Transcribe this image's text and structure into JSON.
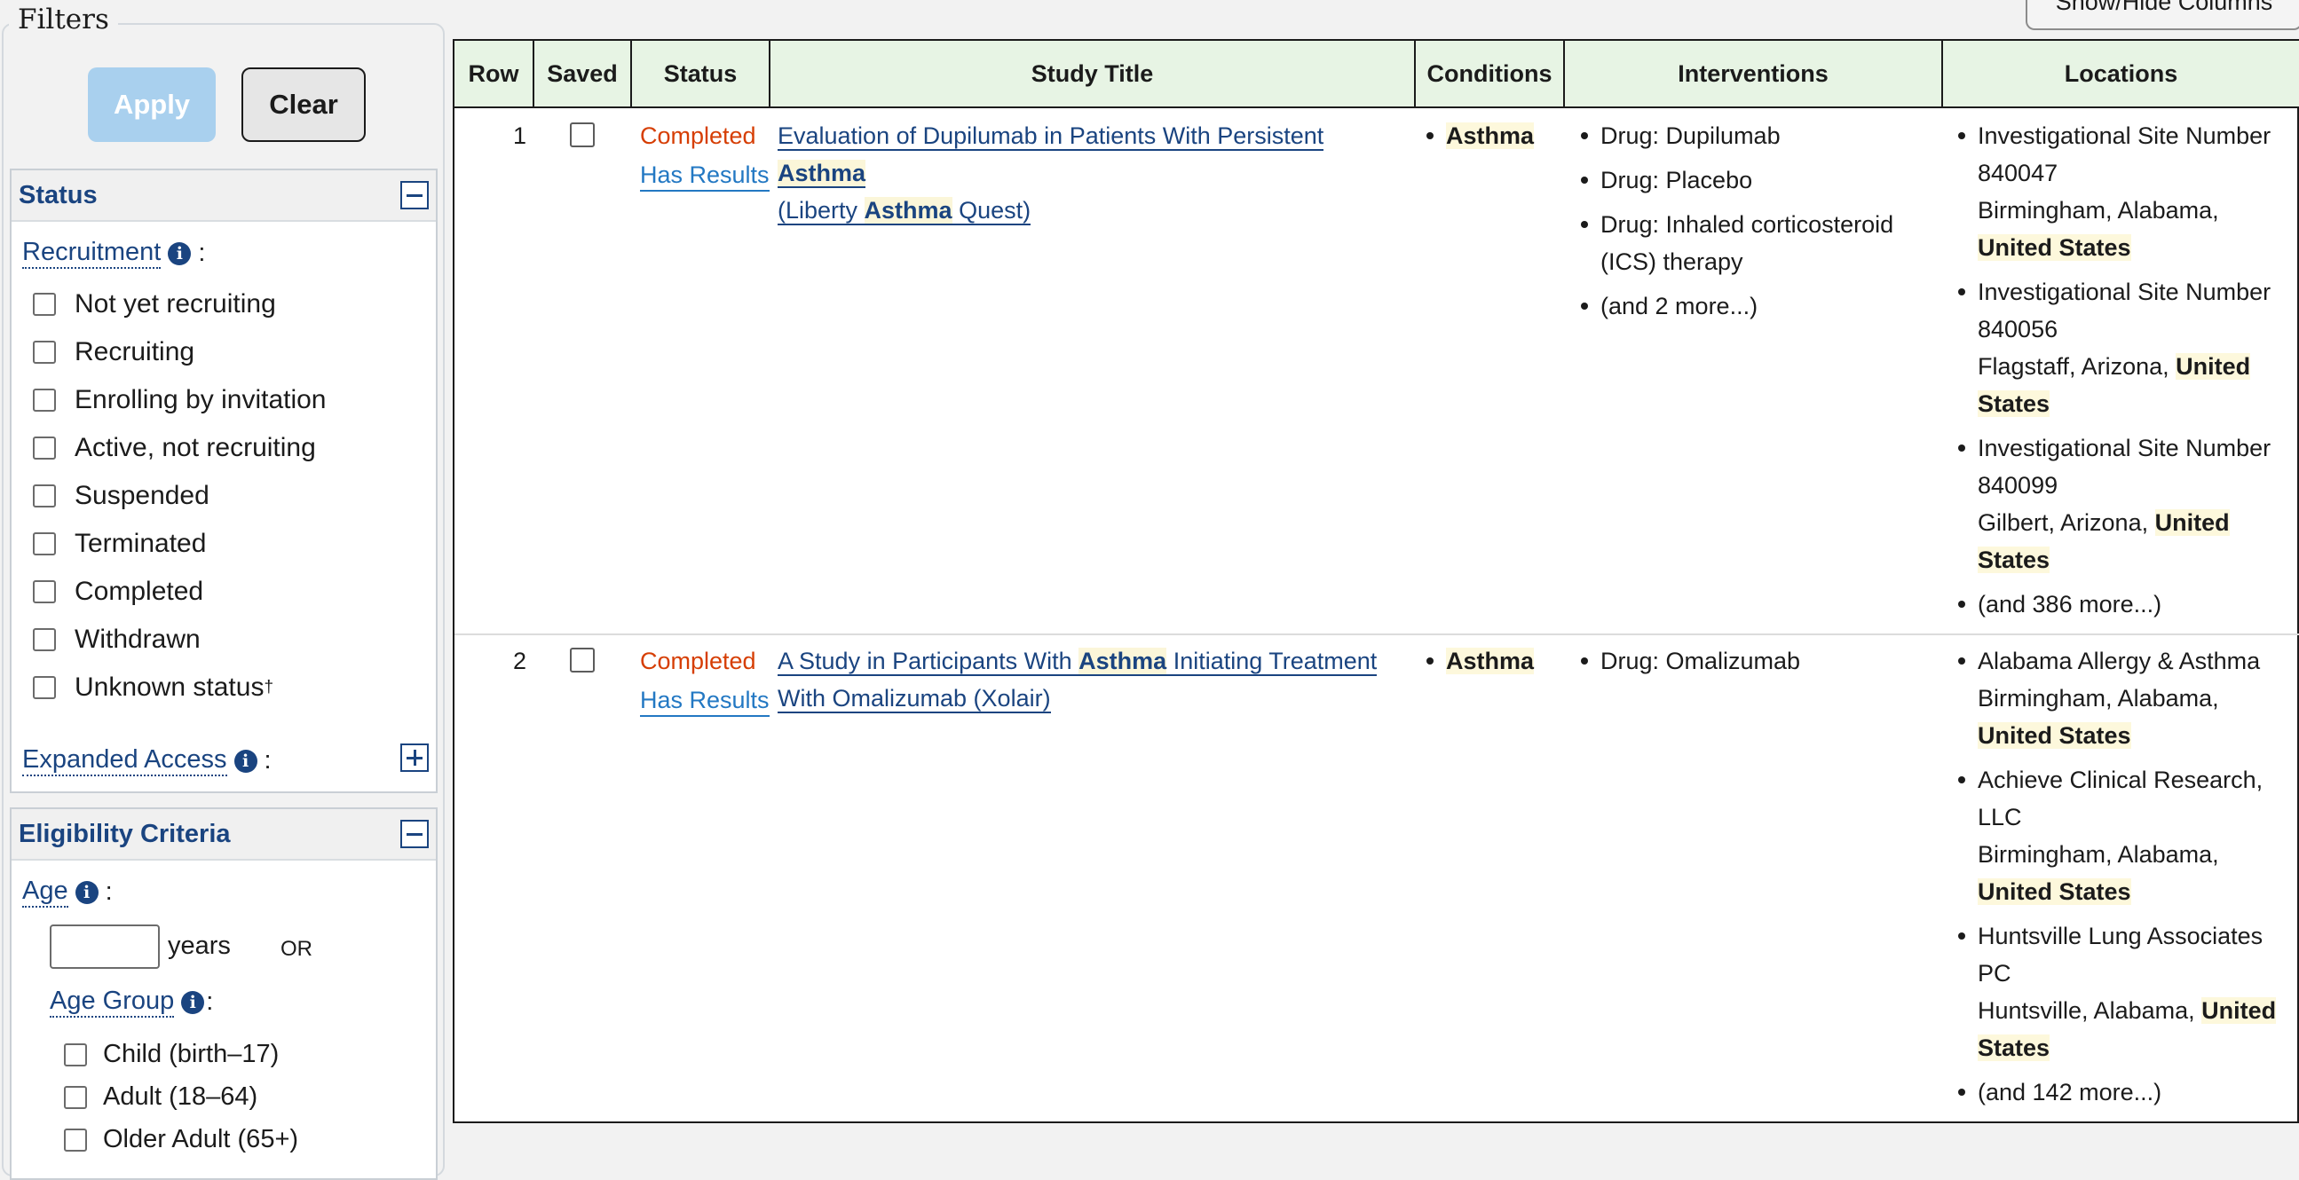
{
  "filters": {
    "legend": "Filters",
    "apply_label": "Apply",
    "clear_label": "Clear"
  },
  "status_section": {
    "title": "Status",
    "recruitment_label": "Recruitment",
    "options": [
      "Not yet recruiting",
      "Recruiting",
      "Enrolling by invitation",
      "Active, not recruiting",
      "Suspended",
      "Terminated",
      "Completed",
      "Withdrawn",
      "Unknown status"
    ],
    "unknown_marker": "†",
    "expanded_access_label": "Expanded Access"
  },
  "eligibility_section": {
    "title": "Eligibility Criteria",
    "age_label": "Age",
    "age_value": "",
    "years_label": "years",
    "or_label": "OR",
    "age_group_label": "Age Group",
    "age_groups": [
      "Child (birth–17)",
      "Adult (18–64)",
      "Older Adult (65+)"
    ]
  },
  "toolbar": {
    "show_hide_label": "Show/Hide Columns"
  },
  "table": {
    "headers": [
      "Row",
      "Saved",
      "Status",
      "Study Title",
      "Conditions",
      "Interventions",
      "Locations"
    ],
    "rows": [
      {
        "row": "1",
        "status": "Completed",
        "results": "Has Results",
        "title_parts": [
          "Evaluation of Dupilumab in Patients With Persistent ",
          "Asthma",
          " (Liberty ",
          "Asthma",
          " Quest)"
        ],
        "title_line1": "Evaluation of Dupilumab in Patients With Persistent ",
        "title_hl1": "Asthma",
        "title_line2a": "(Liberty ",
        "title_hl2": "Asthma",
        "title_line2b": " Quest)",
        "condition": "Asthma",
        "interventions": [
          "Drug: Dupilumab",
          "Drug: Placebo",
          "Drug: Inhaled corticosteroid (ICS) therapy",
          "(and 2 more...)"
        ],
        "locations": [
          {
            "name": "Investigational Site Number 840047",
            "city": "Birmingham, Alabama,",
            "country": "United States"
          },
          {
            "name": "Investigational Site Number 840056",
            "city": "Flagstaff, Arizona,",
            "country": "United States"
          },
          {
            "name": "Investigational Site Number 840099",
            "city": "Gilbert, Arizona,",
            "country": "United States"
          }
        ],
        "more_locations": "(and 386 more...)"
      },
      {
        "row": "2",
        "status": "Completed",
        "results": "Has Results",
        "title_line1a": "A Study in Participants With ",
        "title_hl1": "Asthma",
        "title_line1b": " Initiating Treatment",
        "title_line2": "With Omalizumab (Xolair)",
        "condition": "Asthma",
        "interventions": [
          "Drug: Omalizumab"
        ],
        "locations": [
          {
            "name": "Alabama Allergy & Asthma",
            "city": "Birmingham, Alabama,",
            "country": "United States"
          },
          {
            "name": "Achieve Clinical Research, LLC",
            "city": "Birmingham, Alabama,",
            "country": "United States"
          },
          {
            "name": "Huntsville Lung Associates PC",
            "city": "Huntsville, Alabama,",
            "country": "United States"
          }
        ],
        "more_locations": "(and 142 more...)"
      }
    ]
  }
}
